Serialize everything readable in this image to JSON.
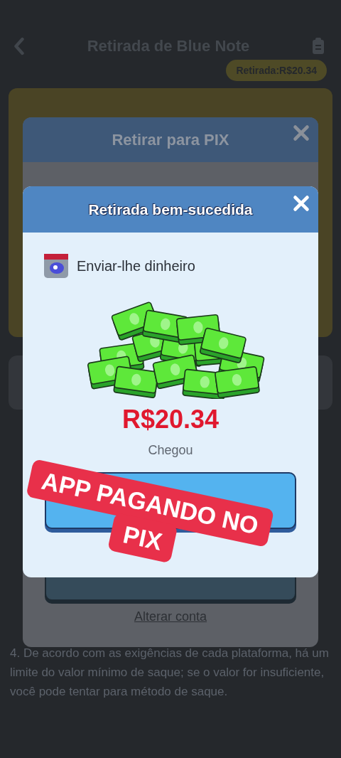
{
  "header": {
    "title": "Retirada de Blue Note"
  },
  "balance_badge": "Retirada:R$20.34",
  "instructions": "4. De acordo com as exigências de cada plataforma, há um limite do valor mínimo de saque; se o valor for insuficiente, você pode tentar para método de saque.",
  "pix_dialog": {
    "title": "Retirar para PIX",
    "link": "Alterar conta"
  },
  "success_dialog": {
    "title": "Retirada bem-sucedida",
    "sender": "Enviar-lhe dinheiro",
    "amount": "R$20.34",
    "status": "Chegou"
  },
  "sticker": {
    "lines": [
      "APP PAGANDO NO",
      "PIX"
    ]
  }
}
